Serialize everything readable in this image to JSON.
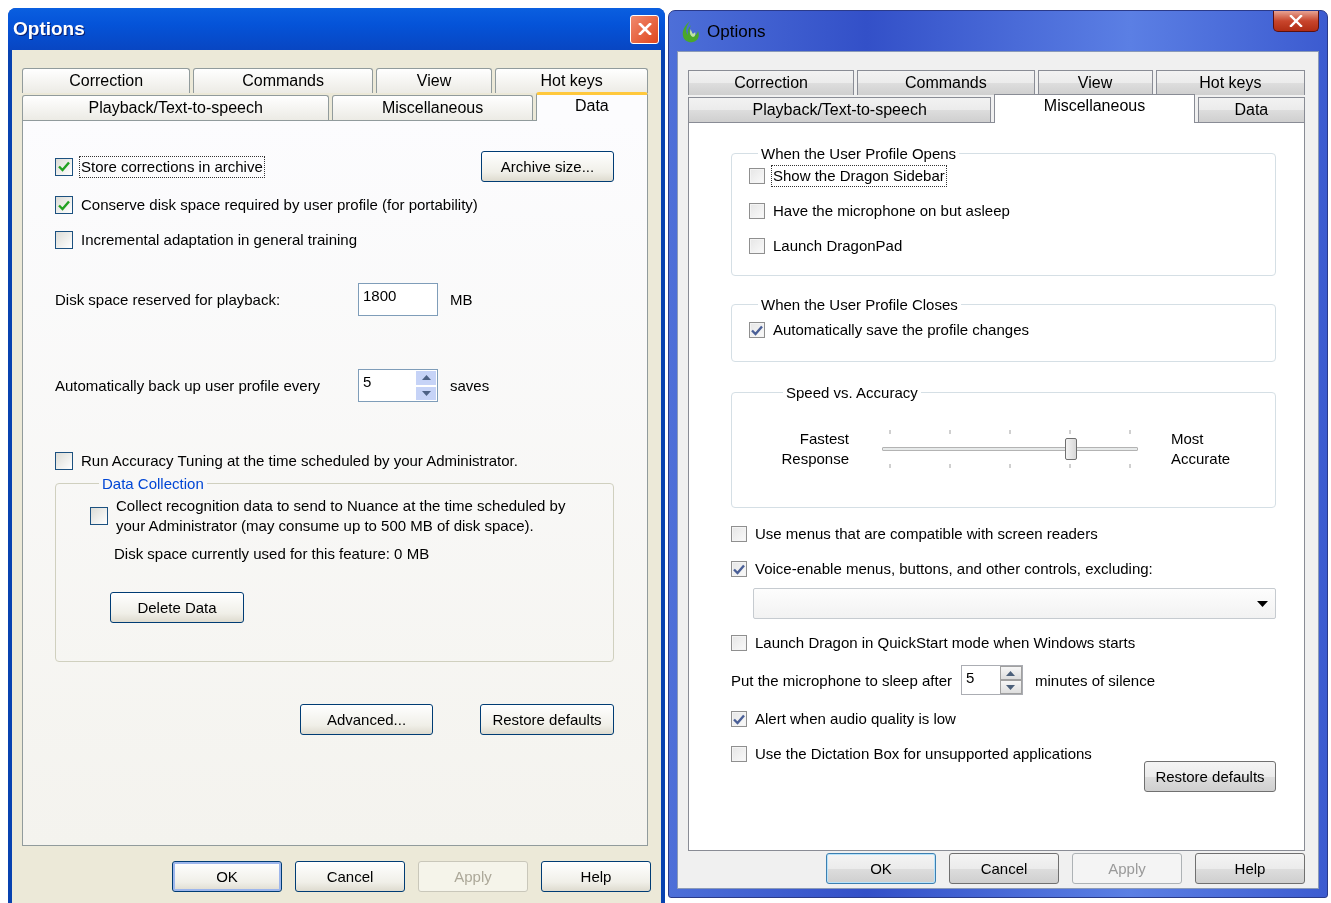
{
  "windows": [
    {
      "kind": "xp",
      "title": "Options",
      "tab_rows": [
        [
          {
            "label": "Correction",
            "selected": false
          },
          {
            "label": "Commands",
            "selected": false
          },
          {
            "label": "View",
            "selected": false
          },
          {
            "label": "Hot keys",
            "selected": false
          }
        ],
        [
          {
            "label": "Playback/Text-to-speech",
            "selected": false
          },
          {
            "label": "Miscellaneous",
            "selected": false
          },
          {
            "label": "Data",
            "selected": true
          }
        ]
      ],
      "page": {
        "kind": "data",
        "options": [
          {
            "label": "Store corrections in archive",
            "checked": true,
            "focused": true
          },
          {
            "label": "Conserve disk space required by user profile (for portability)",
            "checked": true,
            "focused": false
          },
          {
            "label": "Incremental adaptation in general training",
            "checked": false,
            "focused": false
          }
        ],
        "archive_button": "Archive size...",
        "fields": [
          {
            "kind": "text",
            "label": "Disk space reserved for playback:",
            "value": "1800",
            "unit": "MB"
          },
          {
            "kind": "spin",
            "label": "Automatically back up user profile every",
            "value": "5",
            "unit": "saves"
          }
        ],
        "tuning": {
          "label": "Run Accuracy Tuning at the time scheduled by your Administrator.",
          "checked": false,
          "focused": false
        },
        "data_collection": {
          "title": "Data Collection",
          "option": {
            "label": "Collect recognition data to send to Nuance at the time scheduled by your Administrator (may consume up to 500 MB of disk space).",
            "checked": false,
            "focused": false
          },
          "usage": "Disk space currently used for this feature: 0 MB",
          "delete_button": "Delete Data"
        },
        "buttons": [
          "Advanced...",
          "Restore defaults"
        ]
      },
      "footer": [
        {
          "label": "OK",
          "default": true,
          "disabled": false
        },
        {
          "label": "Cancel",
          "default": false,
          "disabled": false
        },
        {
          "label": "Apply",
          "default": false,
          "disabled": true
        },
        {
          "label": "Help",
          "default": false,
          "disabled": false
        }
      ]
    },
    {
      "kind": "win7",
      "title": "Options",
      "tab_rows": [
        [
          {
            "label": "Correction",
            "selected": false
          },
          {
            "label": "Commands",
            "selected": false
          },
          {
            "label": "View",
            "selected": false
          },
          {
            "label": "Hot keys",
            "selected": false
          }
        ],
        [
          {
            "label": "Playback/Text-to-speech",
            "selected": false
          },
          {
            "label": "Miscellaneous",
            "selected": true
          },
          {
            "label": "Data",
            "selected": false
          }
        ]
      ],
      "page": {
        "kind": "misc",
        "groups": [
          {
            "title": "When the User Profile Opens",
            "options": [
              {
                "label": "Show the Dragon Sidebar",
                "checked": false,
                "focused": true
              },
              {
                "label": "Have the microphone on but asleep",
                "checked": false,
                "focused": false
              },
              {
                "label": "Launch DragonPad",
                "checked": false,
                "focused": false
              }
            ]
          },
          {
            "title": "When the User Profile Closes",
            "options": [
              {
                "label": "Automatically save the profile changes",
                "checked": true,
                "focused": false
              }
            ]
          }
        ],
        "speed": {
          "title": "Speed vs. Accuracy",
          "left_label": "Fastest Response",
          "right_label": "Most Accurate",
          "level": 0.75
        },
        "settings": [
          {
            "kind": "checkbox",
            "label": "Use menus that are compatible with screen readers",
            "checked": false,
            "focused": false
          },
          {
            "kind": "checkbox",
            "label": "Voice-enable menus, buttons, and other controls, excluding:",
            "checked": true,
            "focused": false
          },
          {
            "kind": "dropdown"
          },
          {
            "kind": "checkbox",
            "label": "Launch Dragon in QuickStart mode when Windows starts",
            "checked": false,
            "focused": false
          },
          {
            "kind": "spin",
            "label": "Put the microphone to sleep after",
            "value": "5",
            "unit": "minutes of silence"
          },
          {
            "kind": "checkbox",
            "label": "Alert when audio quality is low",
            "checked": true,
            "focused": false
          },
          {
            "kind": "checkbox",
            "label": "Use the Dictation Box for unsupported applications",
            "checked": false,
            "focused": false
          }
        ],
        "restore_button": "Restore defaults"
      },
      "footer": [
        {
          "label": "OK",
          "default": true,
          "disabled": false
        },
        {
          "label": "Cancel",
          "default": false,
          "disabled": false
        },
        {
          "label": "Apply",
          "default": false,
          "disabled": true
        },
        {
          "label": "Help",
          "default": false,
          "disabled": false
        }
      ]
    }
  ]
}
